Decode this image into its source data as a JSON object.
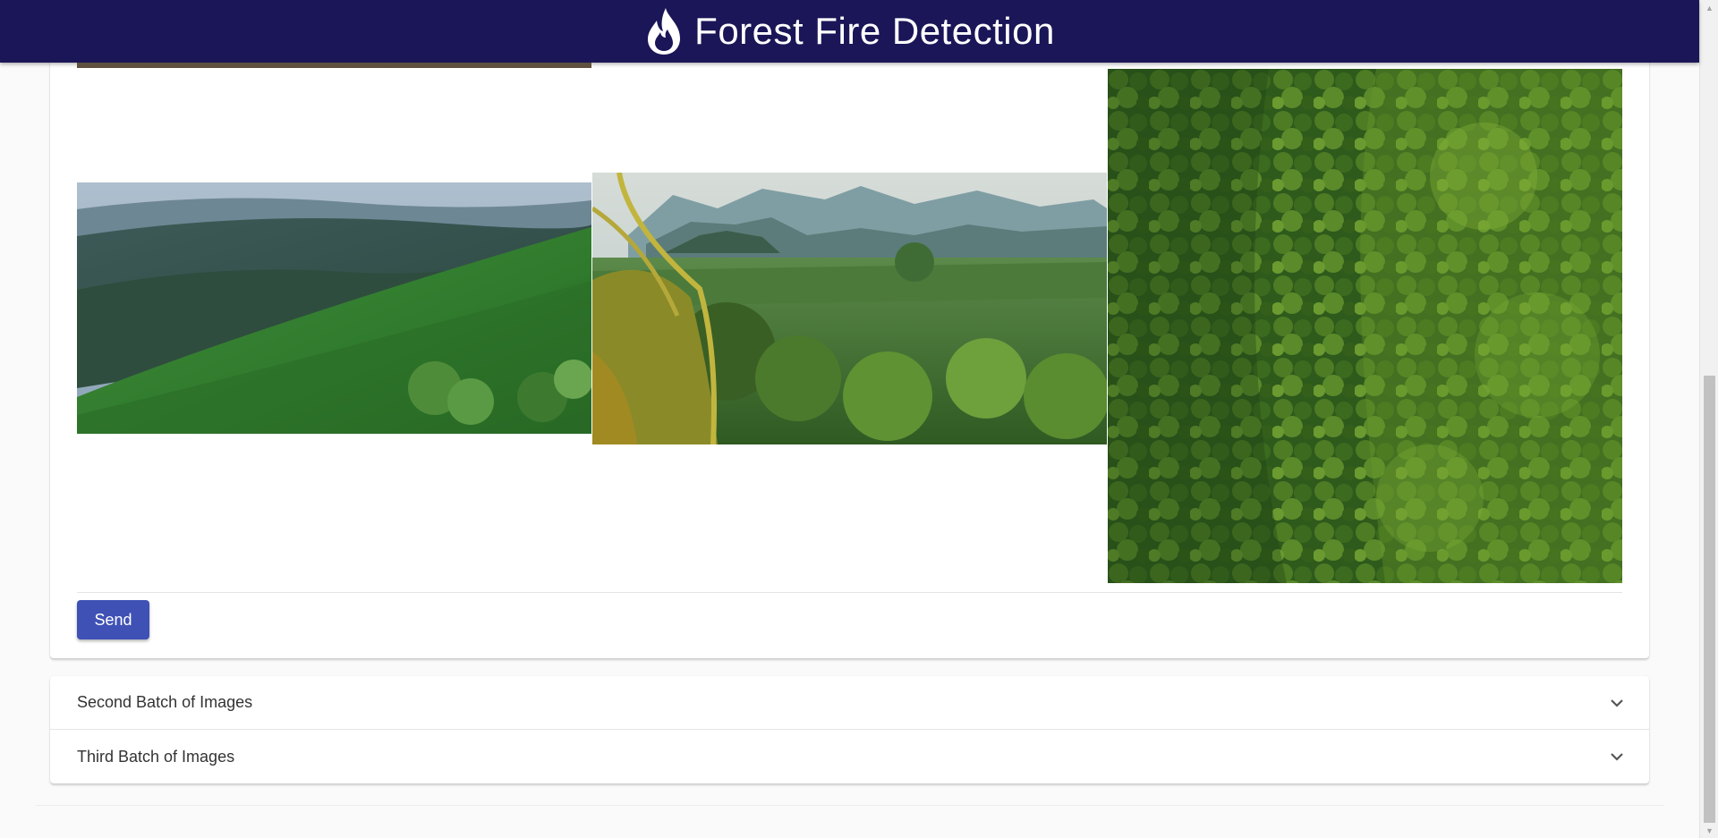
{
  "header": {
    "title": "Forest Fire Detection",
    "icon": "flame-icon",
    "background": "#1b1657"
  },
  "first_batch": {
    "images": [
      {
        "name": "pine-forest-hills"
      },
      {
        "name": "jungle-valley-mountains"
      },
      {
        "name": "aerial-forest-canopy"
      }
    ],
    "send_label": "Send",
    "send_color": "#3f51b5"
  },
  "accordion": {
    "items": [
      {
        "label": "Second Batch of Images",
        "icon": "chevron-down-icon"
      },
      {
        "label": "Third Batch of Images",
        "icon": "chevron-down-icon"
      }
    ]
  }
}
